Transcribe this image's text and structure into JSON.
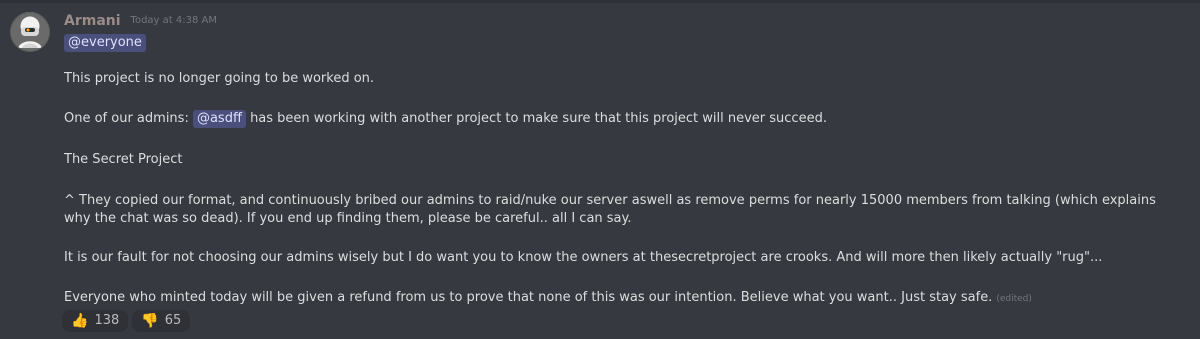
{
  "message": {
    "author": "Armani",
    "timestamp": "Today at 4:38 AM",
    "everyone_mention": "@everyone",
    "line1": "This project is no longer going to be worked on.",
    "line2_prefix": "One of our admins:",
    "line2_mention": "@asdff",
    "line2_suffix": "has been working with another project to make sure that this project will never succeed.",
    "line3": "The Secret Project",
    "line4": "^ They copied our format, and continuously bribed our admins to raid/nuke our server aswell as remove perms for nearly 15000 members from talking (which explains why the chat was so dead). If you end up finding them, please be careful.. all I can say.",
    "line5": "It is our fault for not choosing our admins wisely but I do want you to know the owners at thesecretproject are crooks. And will more then likely actually \"rug\"...",
    "line6": "Everyone who minted today will be given a refund from us to prove that none of this was our intention. Believe what you want.. Just stay safe.",
    "edited_label": "(edited)"
  },
  "reactions": [
    {
      "emoji": "👍",
      "icon": "thumbs-up-icon",
      "count": "138"
    },
    {
      "emoji": "👎",
      "icon": "thumbs-down-icon",
      "count": "65"
    }
  ],
  "colors": {
    "background": "#36393f",
    "text": "#dcddde",
    "mention_bg": "#4b4f7c",
    "mention_text": "#dee0fc",
    "reaction_bg": "#2f3136",
    "reaction_text": "#b9bbbe",
    "muted_text": "#72767d"
  }
}
